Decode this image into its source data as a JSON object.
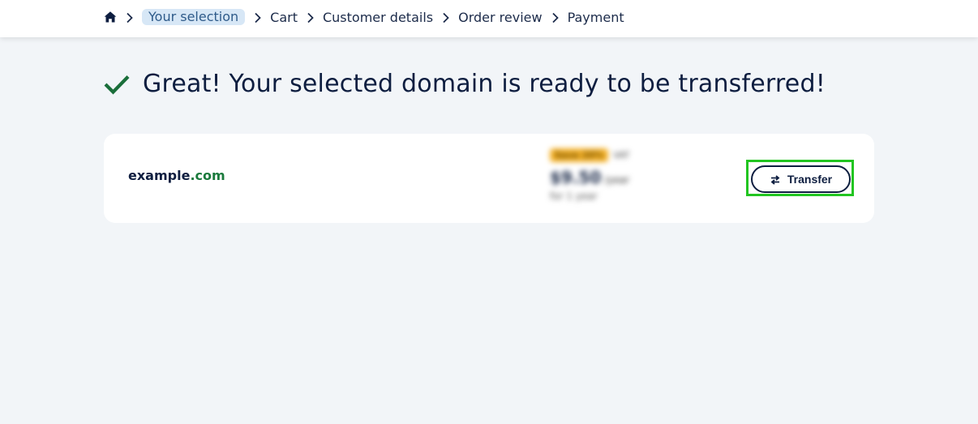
{
  "breadcrumb": {
    "home_icon": "home-icon",
    "items": [
      {
        "label": "Your selection",
        "active": true
      },
      {
        "label": "Cart",
        "active": false
      },
      {
        "label": "Customer details",
        "active": false
      },
      {
        "label": "Order review",
        "active": false
      },
      {
        "label": "Payment",
        "active": false
      }
    ]
  },
  "status": {
    "icon": "check-icon",
    "icon_color": "#1a6e3a",
    "message": "Great! Your selected domain is ready to be transferred!"
  },
  "domain_card": {
    "domain_name": "example",
    "domain_tld": ".com",
    "tld_color": "#1a7a3c",
    "price": {
      "promo_badge": "Save 20%",
      "vat_note": "VAT",
      "amount": "$9.50",
      "period": "/year",
      "term": "for 1 year"
    },
    "transfer_button": {
      "icon": "swap-arrows-icon",
      "label": "Transfer",
      "highlight_color": "#22c521"
    }
  }
}
